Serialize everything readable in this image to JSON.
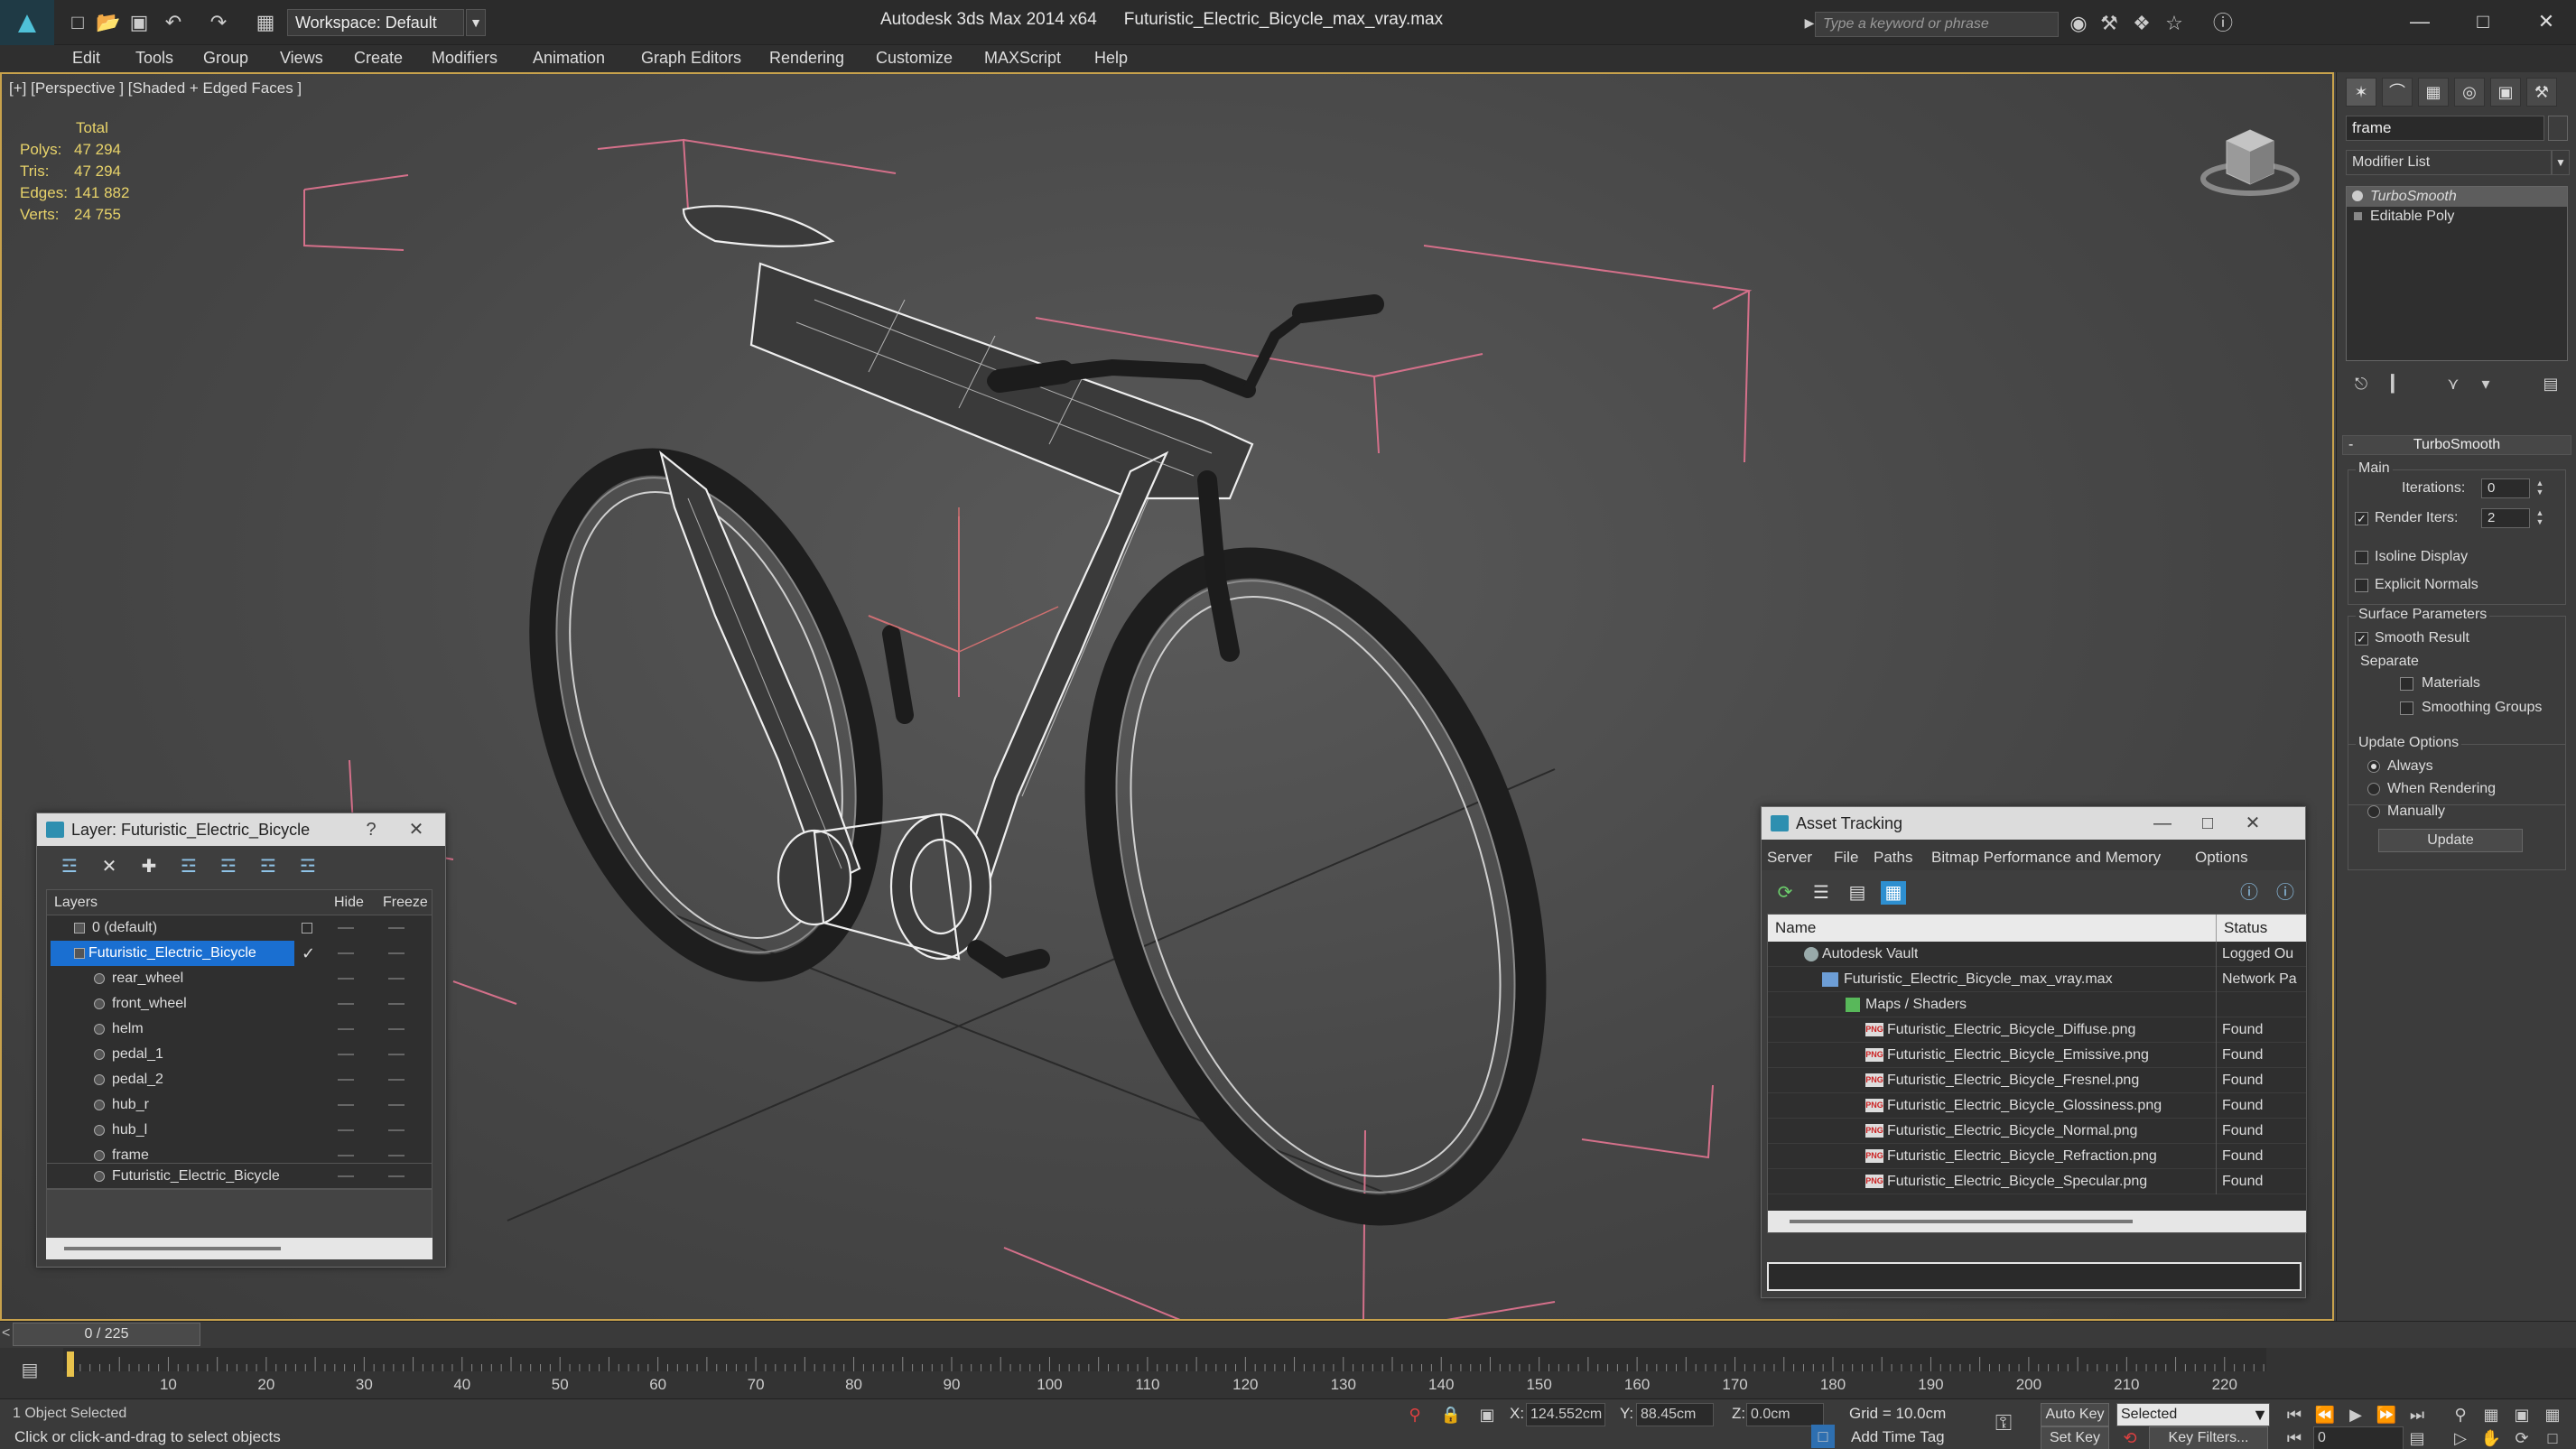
{
  "app": {
    "title": "Autodesk 3ds Max  2014 x64",
    "file": "Futuristic_Electric_Bicycle_max_vray.max",
    "workspace": "Workspace: Default",
    "search_placeholder": "Type a keyword or phrase"
  },
  "menu": [
    "Edit",
    "Tools",
    "Group",
    "Views",
    "Create",
    "Modifiers",
    "Animation",
    "Graph Editors",
    "Rendering",
    "Customize",
    "MAXScript",
    "Help"
  ],
  "viewport": {
    "label": "[+] [Perspective ] [Shaded + Edged Faces ]",
    "stats_header": "Total",
    "stats": [
      {
        "label": "Polys:",
        "value": "47 294"
      },
      {
        "label": "Tris:",
        "value": "47 294"
      },
      {
        "label": "Edges:",
        "value": "141 882"
      },
      {
        "label": "Verts:",
        "value": "24 755"
      }
    ]
  },
  "command_panel": {
    "object_name": "frame",
    "modifier_list": "Modifier List",
    "stack": [
      {
        "name": "TurboSmooth",
        "selected": true
      },
      {
        "name": "Editable Poly",
        "selected": false
      }
    ],
    "rollout_title": "TurboSmooth",
    "main_group": "Main",
    "iterations_label": "Iterations:",
    "iterations_value": "0",
    "render_iters_label": "Render Iters:",
    "render_iters_value": "2",
    "isoline_label": "Isoline Display",
    "explicit_normals_label": "Explicit Normals",
    "surface_group": "Surface Parameters",
    "smooth_result_label": "Smooth Result",
    "separate_label": "Separate",
    "materials_label": "Materials",
    "smoothing_groups_label": "Smoothing Groups",
    "update_group": "Update Options",
    "always_label": "Always",
    "when_rendering_label": "When Rendering",
    "manually_label": "Manually",
    "update_button": "Update"
  },
  "layer_window": {
    "title": "Layer: Futuristic_Electric_Bicycle",
    "help": "?",
    "col_layers": "Layers",
    "col_hide": "Hide",
    "col_freeze": "Freeze",
    "rows": [
      {
        "name": "0 (default)",
        "level": 1,
        "selected": false
      },
      {
        "name": "Futuristic_Electric_Bicycle",
        "level": 1,
        "selected": true
      },
      {
        "name": "rear_wheel",
        "level": 2,
        "selected": false
      },
      {
        "name": "front_wheel",
        "level": 2,
        "selected": false
      },
      {
        "name": "helm",
        "level": 2,
        "selected": false
      },
      {
        "name": "pedal_1",
        "level": 2,
        "selected": false
      },
      {
        "name": "pedal_2",
        "level": 2,
        "selected": false
      },
      {
        "name": "hub_r",
        "level": 2,
        "selected": false
      },
      {
        "name": "hub_l",
        "level": 2,
        "selected": false
      },
      {
        "name": "frame",
        "level": 2,
        "selected": false
      },
      {
        "name": "Futuristic_Electric_Bicycle",
        "level": 2,
        "selected": false
      }
    ]
  },
  "asset_window": {
    "title": "Asset Tracking",
    "menu": [
      "Server",
      "File",
      "Paths",
      "Bitmap Performance and Memory",
      "Options"
    ],
    "col_name": "Name",
    "col_status": "Status",
    "rows": [
      {
        "name": "Autodesk Vault",
        "status": "Logged Ou",
        "indent": 1
      },
      {
        "name": "Futuristic_Electric_Bicycle_max_vray.max",
        "status": "Network Pa",
        "indent": 2
      },
      {
        "name": "Maps / Shaders",
        "status": "",
        "indent": 3
      },
      {
        "name": "Futuristic_Electric_Bicycle_Diffuse.png",
        "status": "Found",
        "indent": 4
      },
      {
        "name": "Futuristic_Electric_Bicycle_Emissive.png",
        "status": "Found",
        "indent": 4
      },
      {
        "name": "Futuristic_Electric_Bicycle_Fresnel.png",
        "status": "Found",
        "indent": 4
      },
      {
        "name": "Futuristic_Electric_Bicycle_Glossiness.png",
        "status": "Found",
        "indent": 4
      },
      {
        "name": "Futuristic_Electric_Bicycle_Normal.png",
        "status": "Found",
        "indent": 4
      },
      {
        "name": "Futuristic_Electric_Bicycle_Refraction.png",
        "status": "Found",
        "indent": 4
      },
      {
        "name": "Futuristic_Electric_Bicycle_Specular.png",
        "status": "Found",
        "indent": 4
      }
    ]
  },
  "timeline": {
    "slider": "0 / 225",
    "ticks": [
      "10",
      "20",
      "30",
      "40",
      "50",
      "60",
      "70",
      "80",
      "90",
      "100",
      "110",
      "120",
      "130",
      "140",
      "150",
      "160",
      "170",
      "180",
      "190",
      "200",
      "210",
      "220"
    ]
  },
  "status": {
    "selection": "1 Object Selected",
    "prompt": "Click or click-and-drag to select objects",
    "x_label": "X:",
    "x_value": "124.552cm",
    "y_label": "Y:",
    "y_value": "88.45cm",
    "z_label": "Z:",
    "z_value": "0.0cm",
    "grid": "Grid = 10.0cm",
    "add_time_tag": "Add Time Tag",
    "auto_key": "Auto Key",
    "set_key": "Set Key",
    "selected_dropdown": "Selected",
    "key_filters": "Key Filters...",
    "frame_value": "0"
  }
}
